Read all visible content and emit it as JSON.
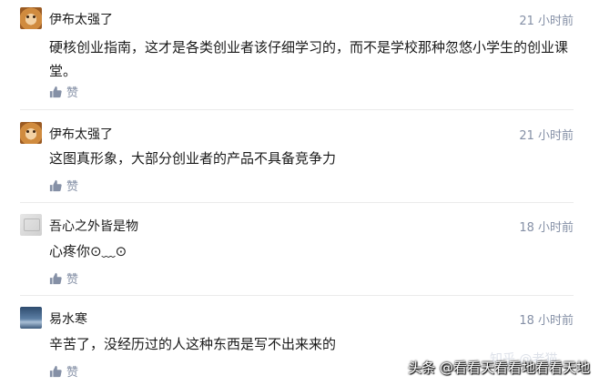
{
  "comments": [
    {
      "author": "伊布太强了",
      "time": "21 小时前",
      "text": "硬核创业指南，这才是各类创业者该仔细学习的，而不是学校那种忽悠小学生的创业课堂。",
      "like_label": "赞",
      "avatar": "shiba-avatar"
    },
    {
      "author": "伊布太强了",
      "time": "21 小时前",
      "text": "这图真形象，大部分创业者的产品不具备竞争力",
      "like_label": "赞",
      "avatar": "shiba-avatar"
    },
    {
      "author": "吾心之外皆是物",
      "time": "18 小时前",
      "text": "心疼你⊙﹏⊙",
      "like_label": "赞",
      "avatar": "grey-avatar"
    },
    {
      "author": "易水寒",
      "time": "18 小时前",
      "text": "辛苦了，没经历过的人这种东西是写不出来来的",
      "like_label": "赞",
      "avatar": "sky-avatar"
    }
  ],
  "watermarks": {
    "zhihu": "知乎 @老猫",
    "toutiao": "头条 @看看天看看地看看天地"
  },
  "colors": {
    "meta_gray": "#8590a6",
    "text": "#1a1a1a",
    "divider": "#ebebeb"
  }
}
